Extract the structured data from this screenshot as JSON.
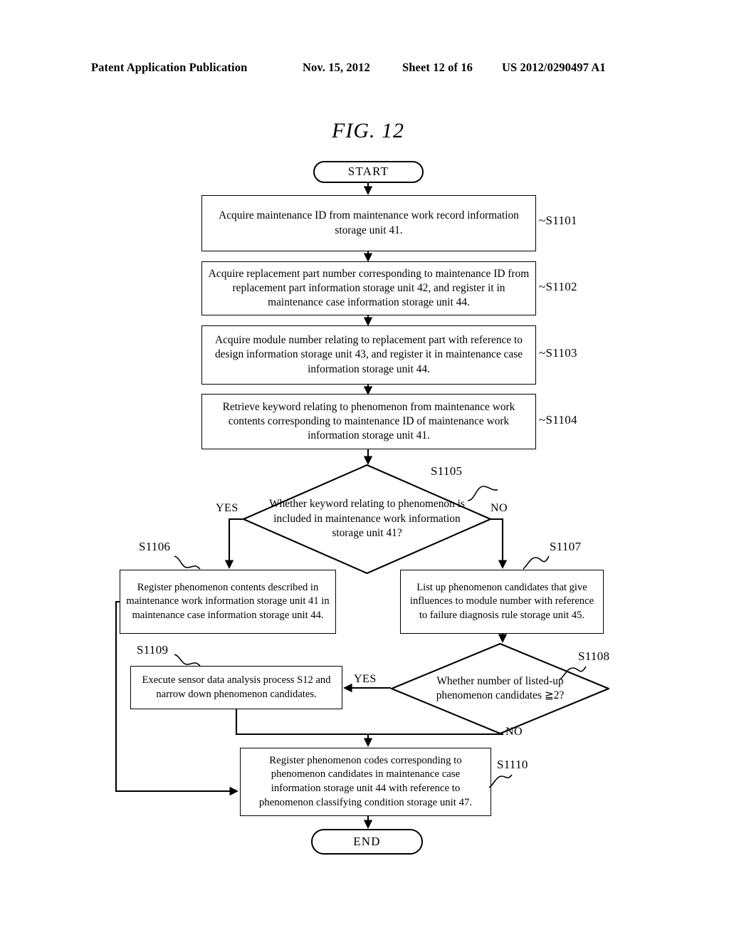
{
  "header": {
    "left": "Patent Application Publication",
    "date": "Nov. 15, 2012",
    "sheet": "Sheet 12 of 16",
    "number": "US 2012/0290497 A1"
  },
  "figure": {
    "title": "FIG.  12"
  },
  "flowchart": {
    "start": {
      "label": "START"
    },
    "end": {
      "label": "END"
    },
    "steps": [
      {
        "id": "S1101",
        "text": "Acquire maintenance ID from maintenance work record information storage unit 41."
      },
      {
        "id": "S1102",
        "text": "Acquire replacement part number corresponding to maintenance ID from replacement part information storage unit 42, and register it in maintenance case information storage unit 44."
      },
      {
        "id": "S1103",
        "text": "Acquire module number relating to replacement part with reference to design information storage unit 43, and register it in maintenance case information storage unit 44."
      },
      {
        "id": "S1104",
        "text": "Retrieve keyword relating to phenomenon from maintenance work contents corresponding to maintenance ID of maintenance work information storage unit 41."
      },
      {
        "id": "S1105",
        "text": "Whether keyword relating to phenomenon is included in maintenance work information storage unit 41?"
      },
      {
        "id": "S1106",
        "text": "Register phenomenon contents described in maintenance work information storage unit 41 in maintenance case information storage unit 44."
      },
      {
        "id": "S1107",
        "text": "List up phenomenon candidates that give influences to module number with reference to failure diagnosis rule storage unit 45."
      },
      {
        "id": "S1108",
        "text": "Whether number of listed-up phenomenon candidates ≧2?"
      },
      {
        "id": "S1109",
        "text": "Execute sensor data analysis process S12 and narrow down phenomenon candidates."
      },
      {
        "id": "S1110",
        "text": "Register phenomenon codes corresponding to phenomenon candidates in maintenance case information storage unit 44 with reference to phenomenon classifying condition storage unit 47."
      }
    ],
    "branch_labels": {
      "d1105_yes": "YES",
      "d1105_no": "NO",
      "d1108_yes": "YES",
      "d1108_no": "NO"
    }
  },
  "colors": {
    "ink": "#000000",
    "paper": "#ffffff"
  }
}
